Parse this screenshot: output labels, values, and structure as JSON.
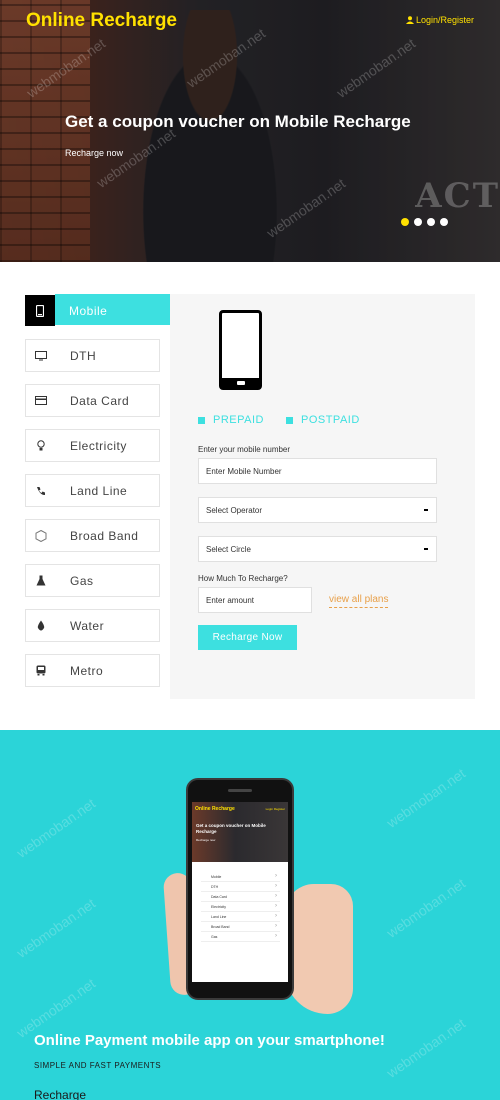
{
  "header": {
    "brand": "Online Recharge",
    "login_label": "Login/Register",
    "icon": "user-icon"
  },
  "hero": {
    "title": "Get a coupon voucher on Mobile Recharge",
    "link": "Recharge now",
    "background_text": "ACT",
    "slides": 4,
    "active_slide": 1
  },
  "colors": {
    "accent": "#3de0e0",
    "brand": "#ffe100",
    "app_section_bg": "#2bd4d8",
    "link": "#e8a04a"
  },
  "tabs": [
    {
      "label": "Mobile",
      "icon": "mobile-icon",
      "active": true
    },
    {
      "label": "DTH",
      "icon": "tv-icon",
      "active": false
    },
    {
      "label": "Data Card",
      "icon": "card-icon",
      "active": false
    },
    {
      "label": "Electricity",
      "icon": "bulb-icon",
      "active": false
    },
    {
      "label": "Land Line",
      "icon": "phone-handset-icon",
      "active": false
    },
    {
      "label": "Broad Band",
      "icon": "globe-icon",
      "active": false
    },
    {
      "label": "Gas",
      "icon": "flask-icon",
      "active": false
    },
    {
      "label": "Water",
      "icon": "drop-icon",
      "active": false
    },
    {
      "label": "Metro",
      "icon": "train-icon",
      "active": false
    }
  ],
  "form": {
    "prepaid": "PREPAID",
    "postpaid": "POSTPAID",
    "mobile_label": "Enter your mobile number",
    "mobile_placeholder": "Enter Mobile Number",
    "operator": "Select Operator",
    "circle": "Select Circle",
    "amount_label": "How Much To Recharge?",
    "amount_placeholder": "Enter amount",
    "plans_link": "view all plans",
    "submit": "Recharge Now"
  },
  "app": {
    "title": "Online Payment mobile app on your smartphone!",
    "subtitle": "SIMPLE AND FAST PAYMENTS",
    "next_heading": "Recharge",
    "mock_brand": "Online Recharge",
    "mock_login": "Login Register",
    "mock_title": "Get a coupon voucher on Mobile Recharge",
    "mock_link": "Recharge now",
    "mock_items": [
      "Mobile",
      "DTH",
      "Data Card",
      "Electricity",
      "Land Line",
      "Broad Band",
      "Gas"
    ]
  },
  "watermark": "webmoban.net"
}
